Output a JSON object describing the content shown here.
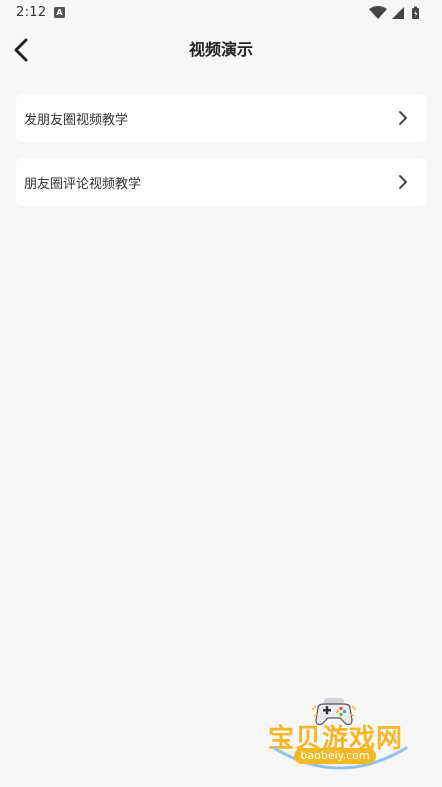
{
  "status_bar": {
    "time": "2:12",
    "notification_icon_letter": "A",
    "icons": [
      "wifi-icon",
      "signal-icon",
      "battery-icon"
    ]
  },
  "header": {
    "title": "视频演示",
    "back_icon": "chevron-left-icon"
  },
  "menu": {
    "items": [
      {
        "label": "发朋友圈视频教学",
        "icon": "chevron-right-icon"
      },
      {
        "label": "朋友圈评论视频教学",
        "icon": "chevron-right-icon"
      }
    ]
  },
  "watermark": {
    "text": "宝贝游戏网",
    "url": "baobeiy.com",
    "icon": "gamepad-icon"
  },
  "colors": {
    "background": "#f7f7f7",
    "card": "#ffffff",
    "text": "#333333",
    "watermark_yellow": "#f6b626"
  }
}
